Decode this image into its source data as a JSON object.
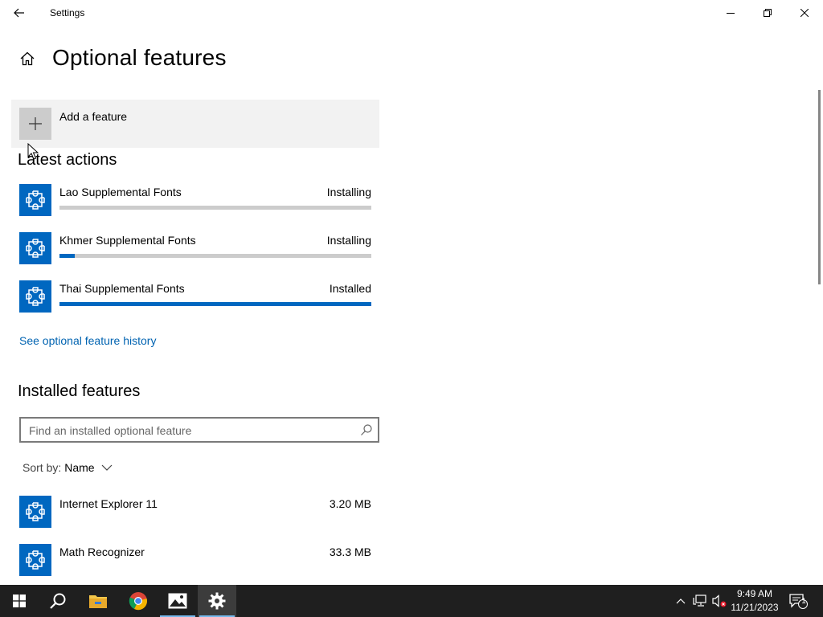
{
  "window": {
    "title": "Settings"
  },
  "page": {
    "title": "Optional features"
  },
  "add_feature": {
    "label": "Add a feature"
  },
  "latest_actions": {
    "title": "Latest actions",
    "items": [
      {
        "name": "Lao Supplemental Fonts",
        "status": "Installing",
        "progress": 0
      },
      {
        "name": "Khmer Supplemental Fonts",
        "status": "Installing",
        "progress": 0.05
      },
      {
        "name": "Thai Supplemental Fonts",
        "status": "Installed",
        "progress": 1.0
      }
    ]
  },
  "history_link": "See optional feature history",
  "installed": {
    "title": "Installed features",
    "search_placeholder": "Find an installed optional feature",
    "sort_label": "Sort by:",
    "sort_value": "Name",
    "items": [
      {
        "name": "Internet Explorer 11",
        "size": "3.20 MB"
      },
      {
        "name": "Math Recognizer",
        "size": "33.3 MB"
      }
    ]
  },
  "taskbar": {
    "time": "9:49 AM",
    "date": "11/21/2023",
    "notification_count": "1",
    "apps": [
      "start-icon",
      "search-icon",
      "file-explorer-icon",
      "chrome-icon",
      "photos-icon",
      "settings-icon"
    ]
  },
  "colors": {
    "accent": "#0067c0",
    "link": "#0063b1",
    "taskbar": "#1f1f1f"
  }
}
